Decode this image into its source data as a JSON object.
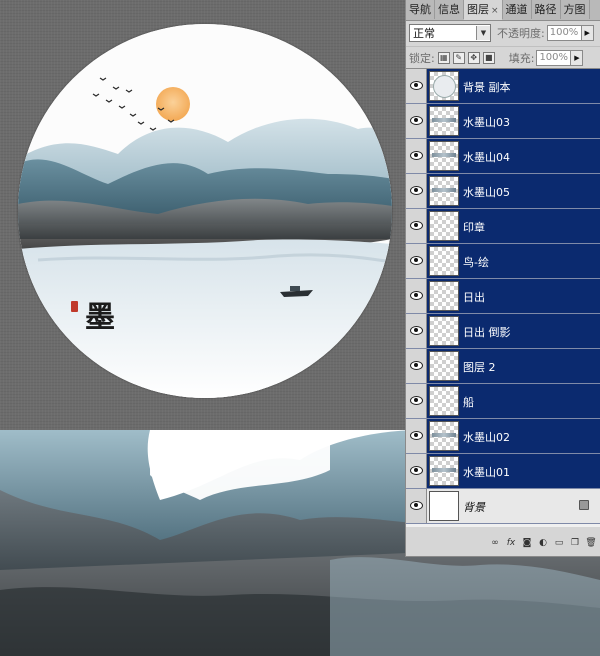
{
  "panel": {
    "tabs": [
      {
        "label": "导航",
        "active": false
      },
      {
        "label": "信息",
        "active": false
      },
      {
        "label": "图层",
        "active": true,
        "close": "×"
      },
      {
        "label": "通道",
        "active": false
      },
      {
        "label": "路径",
        "active": false
      },
      {
        "label": "方图",
        "active": false
      }
    ],
    "blend_mode": "正常",
    "opacity_label": "不透明度:",
    "opacity_value": "100%",
    "lock_label": "锁定:",
    "fill_label": "填充:",
    "fill_value": "100%"
  },
  "layers": [
    {
      "name": "背景 副本",
      "selected": true,
      "thumb": "circle"
    },
    {
      "name": "水墨山03",
      "selected": true,
      "thumb": "mtn"
    },
    {
      "name": "水墨山04",
      "selected": true,
      "thumb": "mtn"
    },
    {
      "name": "水墨山05",
      "selected": true,
      "thumb": "mtn"
    },
    {
      "name": "印章",
      "selected": true,
      "thumb": "transparent"
    },
    {
      "name": "鸟-绘",
      "selected": true,
      "thumb": "transparent"
    },
    {
      "name": "日出",
      "selected": true,
      "thumb": "transparent"
    },
    {
      "name": "日出 倒影",
      "selected": true,
      "thumb": "transparent"
    },
    {
      "name": "图层 2",
      "selected": true,
      "thumb": "transparent"
    },
    {
      "name": "船",
      "selected": true,
      "thumb": "transparent"
    },
    {
      "name": "水墨山02",
      "selected": true,
      "thumb": "mtn"
    },
    {
      "name": "水墨山01",
      "selected": true,
      "thumb": "mtn"
    },
    {
      "name": "背景",
      "selected": false,
      "thumb": "white",
      "locked": true
    }
  ],
  "footer_icons": [
    "link-icon",
    "fx-icon",
    "mask-icon",
    "adjustment-icon",
    "folder-icon",
    "new-layer-icon",
    "trash-icon"
  ],
  "artwork": {
    "seal_char": "墨"
  },
  "colors": {
    "selection": "#0b2a6f",
    "panel_bg": "#d6d6d6",
    "sun": "#f5b45a",
    "ink_teal": "#2f5f73"
  }
}
